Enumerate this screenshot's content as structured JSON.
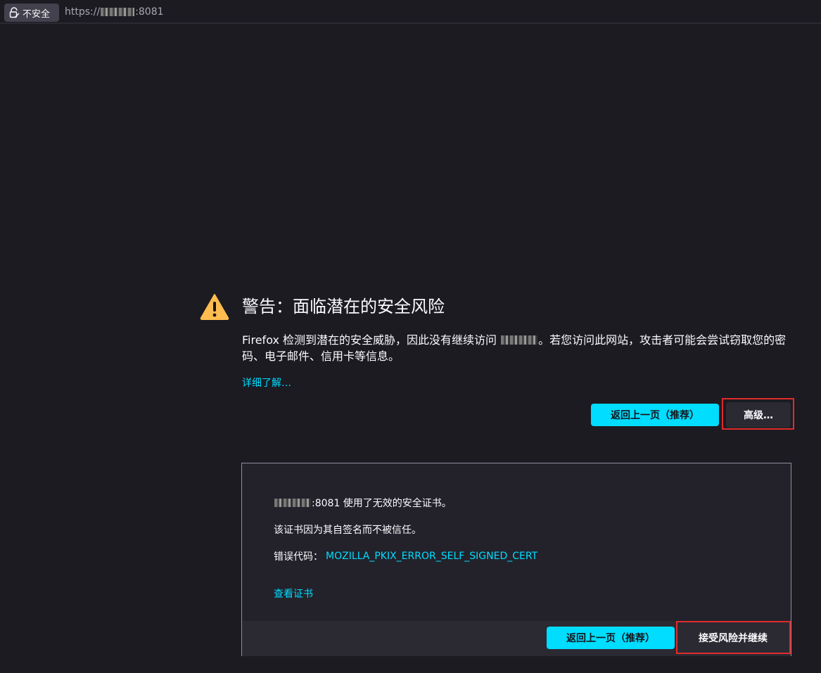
{
  "urlbar": {
    "insecure_label": "不安全",
    "url_prefix": "https://",
    "url_port": ":8081"
  },
  "warning": {
    "title": "警告：面临潜在的安全风险",
    "desc_part1": "Firefox 检测到潜在的安全威胁，因此没有继续访问 ",
    "desc_part2": "。若您访问此网站，攻击者可能会尝试窃取您的密码、电子邮件、信用卡等信息。",
    "learn_more": "详细了解…",
    "go_back": "返回上一页（推荐）",
    "advanced": "高级…"
  },
  "advanced_panel": {
    "line1_suffix": ":8081 使用了无效的安全证书。",
    "line2": "该证书因为其自签名而不被信任。",
    "error_label": "错误代码：",
    "error_code": "MOZILLA_PKIX_ERROR_SELF_SIGNED_CERT",
    "view_cert": "查看证书",
    "go_back": "返回上一页（推荐）",
    "accept_risk": "接受风险并继续"
  },
  "colors": {
    "background": "#1c1b22",
    "accent": "#00ddff",
    "warning_icon": "#ffbd4f",
    "highlight": "#e22b2b"
  }
}
